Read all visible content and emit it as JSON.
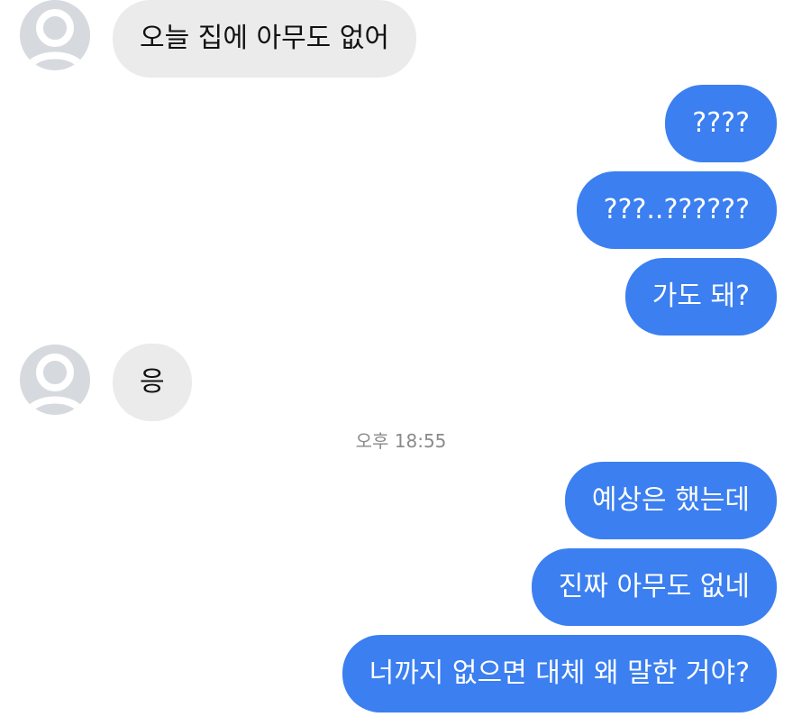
{
  "conversation": {
    "messages": [
      {
        "sender": "other",
        "text": "오늘 집에 아무도 없어"
      },
      {
        "sender": "me",
        "text": "????"
      },
      {
        "sender": "me",
        "text": "???..??????"
      },
      {
        "sender": "me",
        "text": "가도 돼?"
      },
      {
        "sender": "other",
        "text": "응"
      },
      {
        "sender": "me",
        "text": "예상은 했는데"
      },
      {
        "sender": "me",
        "text": "진짜 아무도 없네"
      },
      {
        "sender": "me",
        "text": "너까지 없으면 대체 왜 말한 거야?"
      }
    ],
    "timestamp": "오후 18:55"
  },
  "colors": {
    "outgoing_bubble": "#3b7ff0",
    "incoming_bubble": "#ebebec",
    "background": "#ffffff",
    "avatar": "#d6d9de"
  },
  "icons": {
    "avatar": "default-profile-icon"
  }
}
